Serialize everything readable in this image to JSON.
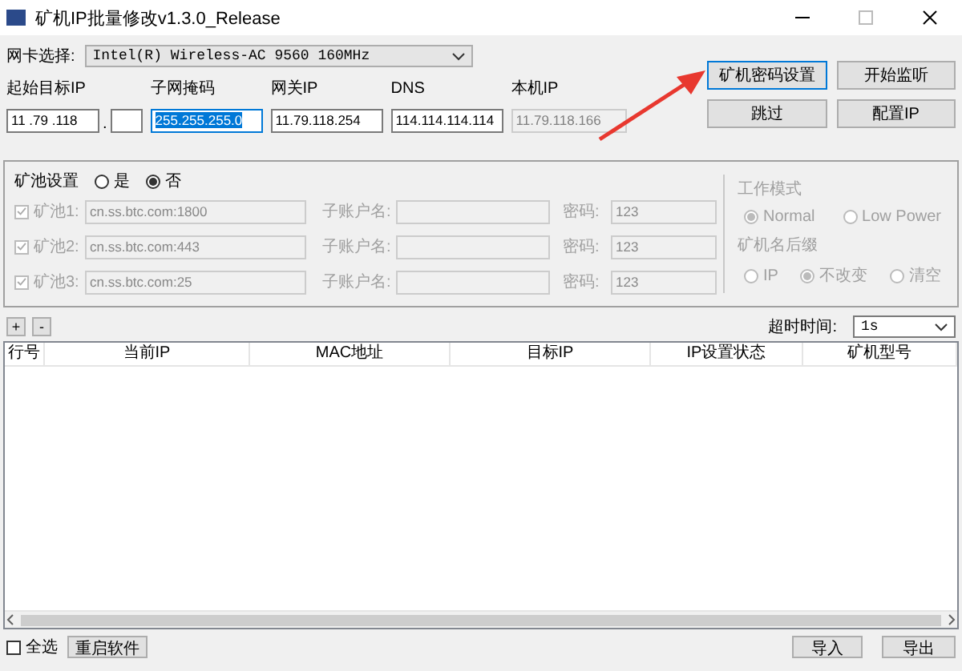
{
  "window": {
    "title": "矿机IP批量修改v1.3.0_Release"
  },
  "adapter": {
    "label": "网卡选择:",
    "value": "Intel(R) Wireless-AC 9560 160MHz"
  },
  "network": [
    {
      "label": "起始目标IP",
      "value": "11 .79 .118",
      "separator": ".",
      "kind": "split",
      "highlighted": false,
      "disabled": false
    },
    {
      "label": "子网掩码",
      "value": "255.255.255.0",
      "kind": "plain",
      "highlighted": true,
      "disabled": false
    },
    {
      "label": "网关IP",
      "value": "11.79.118.254",
      "kind": "plain",
      "highlighted": false,
      "disabled": false
    },
    {
      "label": "DNS",
      "value": "114.114.114.114",
      "kind": "plain",
      "highlighted": false,
      "disabled": false
    },
    {
      "label": "本机IP",
      "value": "11.79.118.166",
      "kind": "plain",
      "highlighted": false,
      "disabled": true
    }
  ],
  "actions": [
    "矿机密码设置",
    "开始监听",
    "跳过",
    "配置IP"
  ],
  "pool_settings": {
    "title": "矿池设置",
    "options": [
      {
        "label": "是",
        "selected": false
      },
      {
        "label": "否",
        "selected": true
      }
    ],
    "pools": [
      {
        "label": "矿池1:",
        "checked": true,
        "disabled": true,
        "address": "cn.ss.btc.com:1800",
        "account_label": "子账户名:",
        "password_label": "密码:",
        "password": "123"
      },
      {
        "label": "矿池2:",
        "checked": true,
        "disabled": true,
        "address": "cn.ss.btc.com:443",
        "account_label": "子账户名:",
        "password_label": "密码:",
        "password": "123"
      },
      {
        "label": "矿池3:",
        "checked": true,
        "disabled": true,
        "address": "cn.ss.btc.com:25",
        "account_label": "子账户名:",
        "password_label": "密码:",
        "password": "123"
      }
    ],
    "work_mode": {
      "title": "工作模式",
      "options": [
        {
          "label": "Normal",
          "selected": true
        },
        {
          "label": "Low Power",
          "selected": false
        }
      ]
    },
    "name_suffix": {
      "title": "矿机名后缀",
      "options": [
        {
          "label": "IP",
          "selected": false
        },
        {
          "label": "不改变",
          "selected": true
        },
        {
          "label": "清空",
          "selected": false
        }
      ]
    }
  },
  "toolbar": {
    "add": "+",
    "remove": "-",
    "timeout_label": "超时时间:",
    "timeout_value": "1s"
  },
  "table": {
    "columns": [
      "行号",
      "当前IP",
      "MAC地址",
      "目标IP",
      "IP设置状态",
      "矿机型号"
    ]
  },
  "footer": {
    "select_all": {
      "label": "全选",
      "checked": false
    },
    "restart": "重启软件",
    "import": "导入",
    "export": "导出"
  }
}
